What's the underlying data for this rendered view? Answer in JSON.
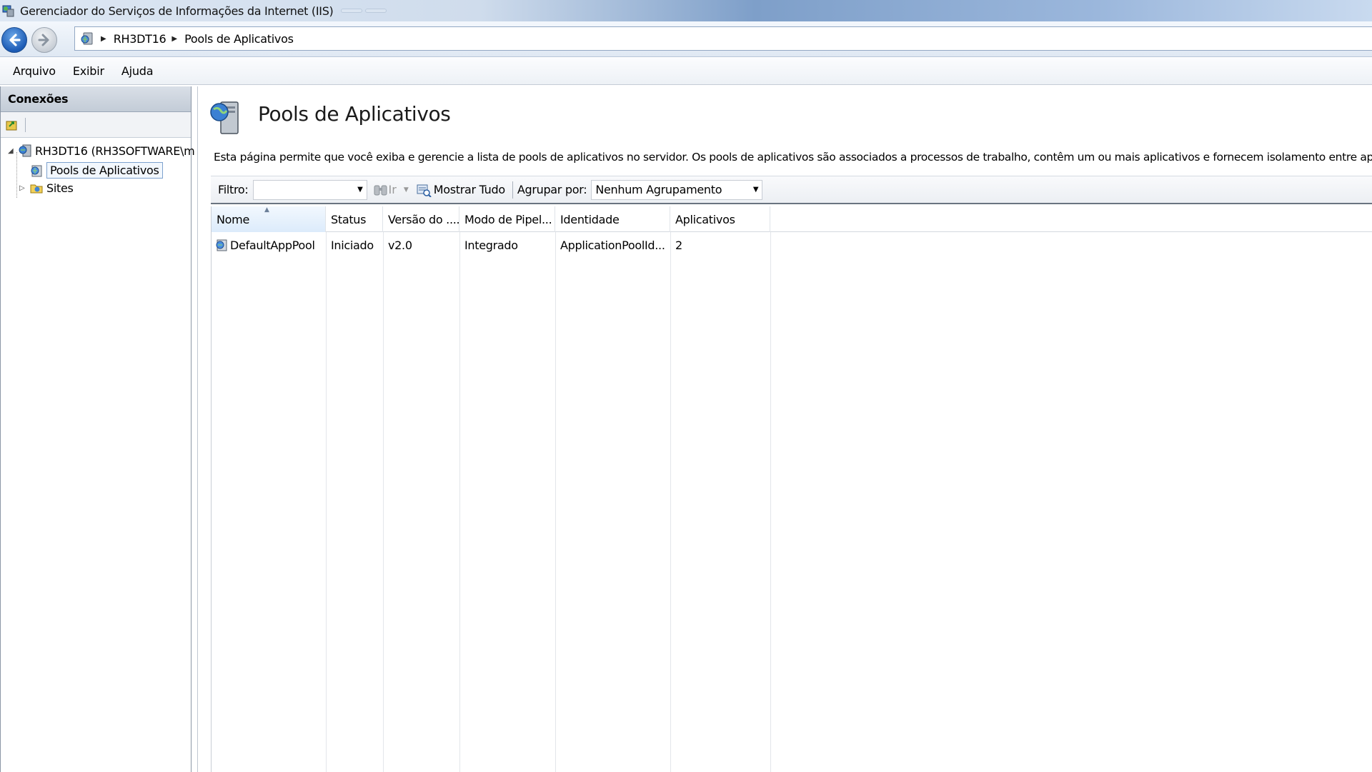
{
  "window": {
    "title": "Gerenciador do Serviços de Informações da Internet (IIS)",
    "background_tabs": [
      "",
      ""
    ]
  },
  "navigation": {
    "back_icon": "back-arrow-icon",
    "forward_icon": "forward-arrow-icon",
    "breadcrumb": [
      "RH3DT16",
      "Pools de Aplicativos"
    ]
  },
  "menu": [
    "Arquivo",
    "Exibir",
    "Ajuda"
  ],
  "connections": {
    "header": "Conexões",
    "server_node": "RH3DT16 (RH3SOFTWARE\\m",
    "children": [
      "Pools de Aplicativos",
      "Sites"
    ]
  },
  "page": {
    "title": "Pools de Aplicativos",
    "description": "Esta página permite que você exiba e gerencie a lista de pools de aplicativos no servidor. Os pools de aplicativos são associados a processos de trabalho, contêm um ou mais aplicativos e fornecem isolamento entre aplicativos diferentes."
  },
  "filter_bar": {
    "filter_label": "Filtro:",
    "filter_value": "",
    "go_label": "Ir",
    "show_all_label": "Mostrar Tudo",
    "group_by_label": "Agrupar por:",
    "group_by_value": "Nenhum Agrupamento"
  },
  "grid": {
    "columns": [
      "Nome",
      "Status",
      "Versão do ....",
      "Modo de Pipel...",
      "Identidade",
      "Aplicativos"
    ],
    "sorted_column": "Nome",
    "rows": [
      [
        "DefaultAppPool",
        "Iniciado",
        "v2.0",
        "Integrado",
        "ApplicationPoolId...",
        "2"
      ]
    ]
  }
}
